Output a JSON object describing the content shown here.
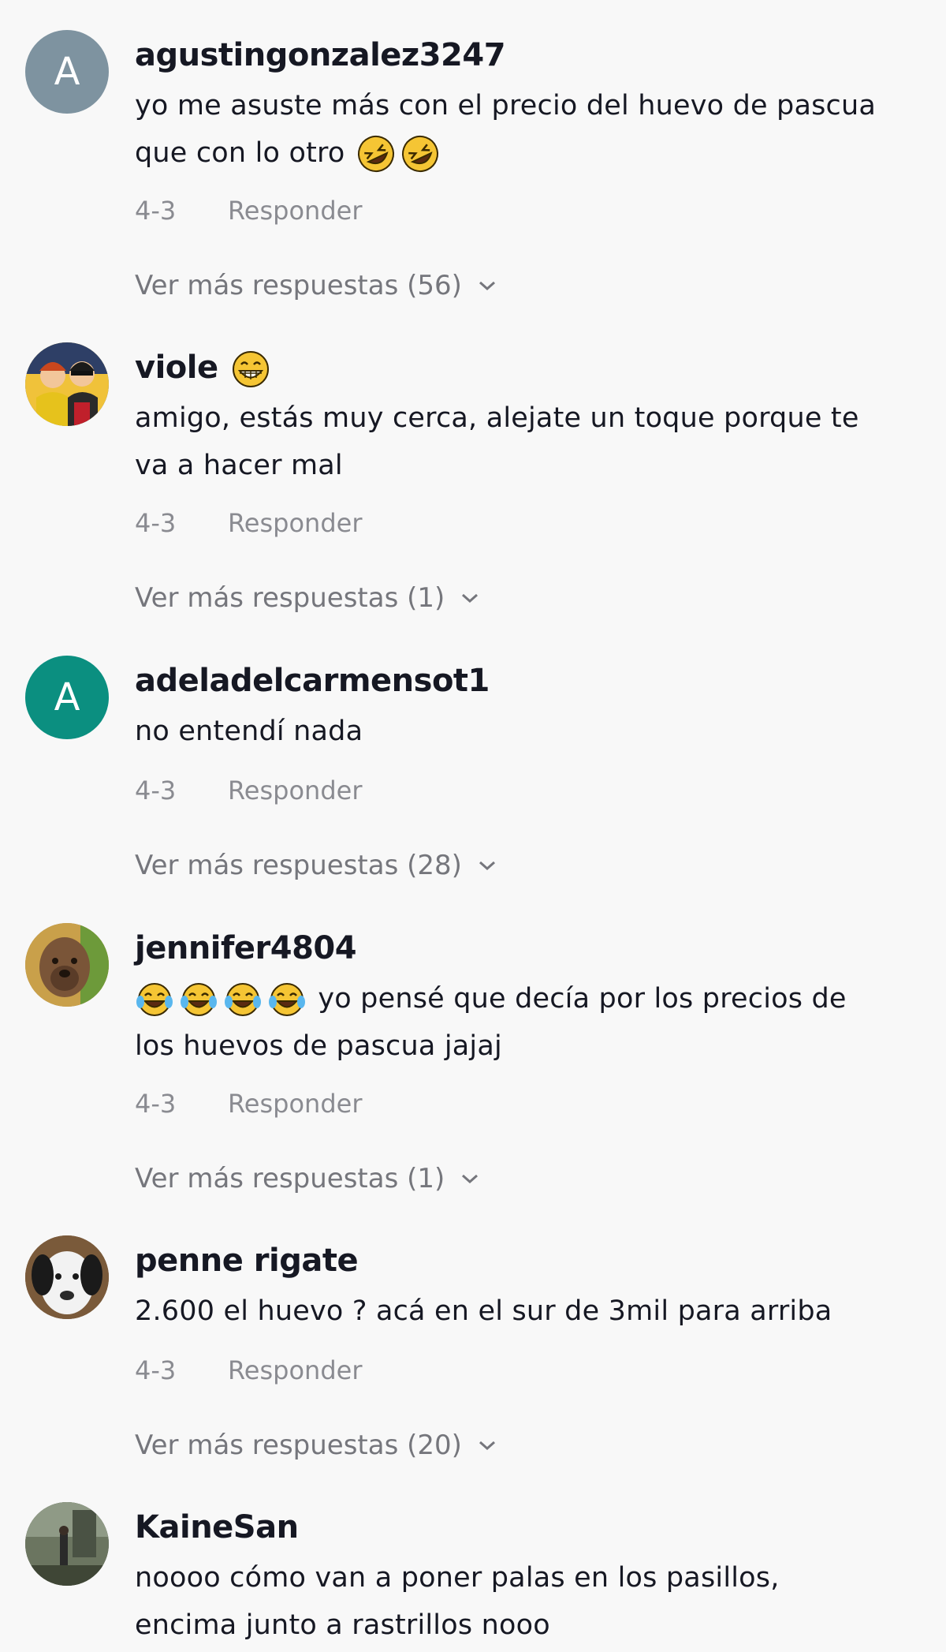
{
  "comments": [
    {
      "username": "agustingonzalez3247",
      "avatar_letter": "A",
      "avatar_color": "#7e93a0",
      "text_line1": "yo me asuste más con el precio del huevo de pascua",
      "text_line2": "que con lo otro",
      "date": "4-3",
      "reply_label": "Responder",
      "more_label": "Ver más respuestas (56)"
    },
    {
      "username": "viole",
      "text_line1": "amigo, estás muy cerca, alejate un toque porque te",
      "text_line2": "va a hacer mal",
      "date": "4-3",
      "reply_label": "Responder",
      "more_label": "Ver más respuestas (1)"
    },
    {
      "username": "adeladelcarmensot1",
      "avatar_letter": "A",
      "avatar_color": "#0b8f80",
      "text_line1": "no entendí nada",
      "date": "4-3",
      "reply_label": "Responder",
      "more_label": "Ver más respuestas (28)"
    },
    {
      "username": "jennifer4804",
      "text_line1": "yo pensé que decía por los precios de",
      "text_line2": "los huevos de pascua jajaj",
      "date": "4-3",
      "reply_label": "Responder",
      "more_label": "Ver más respuestas (1)"
    },
    {
      "username": "penne rigate",
      "text_line1": "2.600 el huevo ? acá en el sur de 3mil para arriba",
      "date": "4-3",
      "reply_label": "Responder",
      "more_label": "Ver más respuestas (20)"
    },
    {
      "username": "KaineSan",
      "text_line1": "noooo cómo van a poner palas en los pasillos,",
      "text_line2": "encima junto a rastrillos nooo"
    }
  ],
  "colors": {
    "background": "#f8f8f8",
    "username": "#161823",
    "meta": "#8a8b91",
    "emoji_yellow": "#f5c534"
  },
  "icons": [
    "rolling-laughing-emoji",
    "grinning-emoji",
    "tears-of-joy-emoji",
    "chevron-down-icon"
  ]
}
